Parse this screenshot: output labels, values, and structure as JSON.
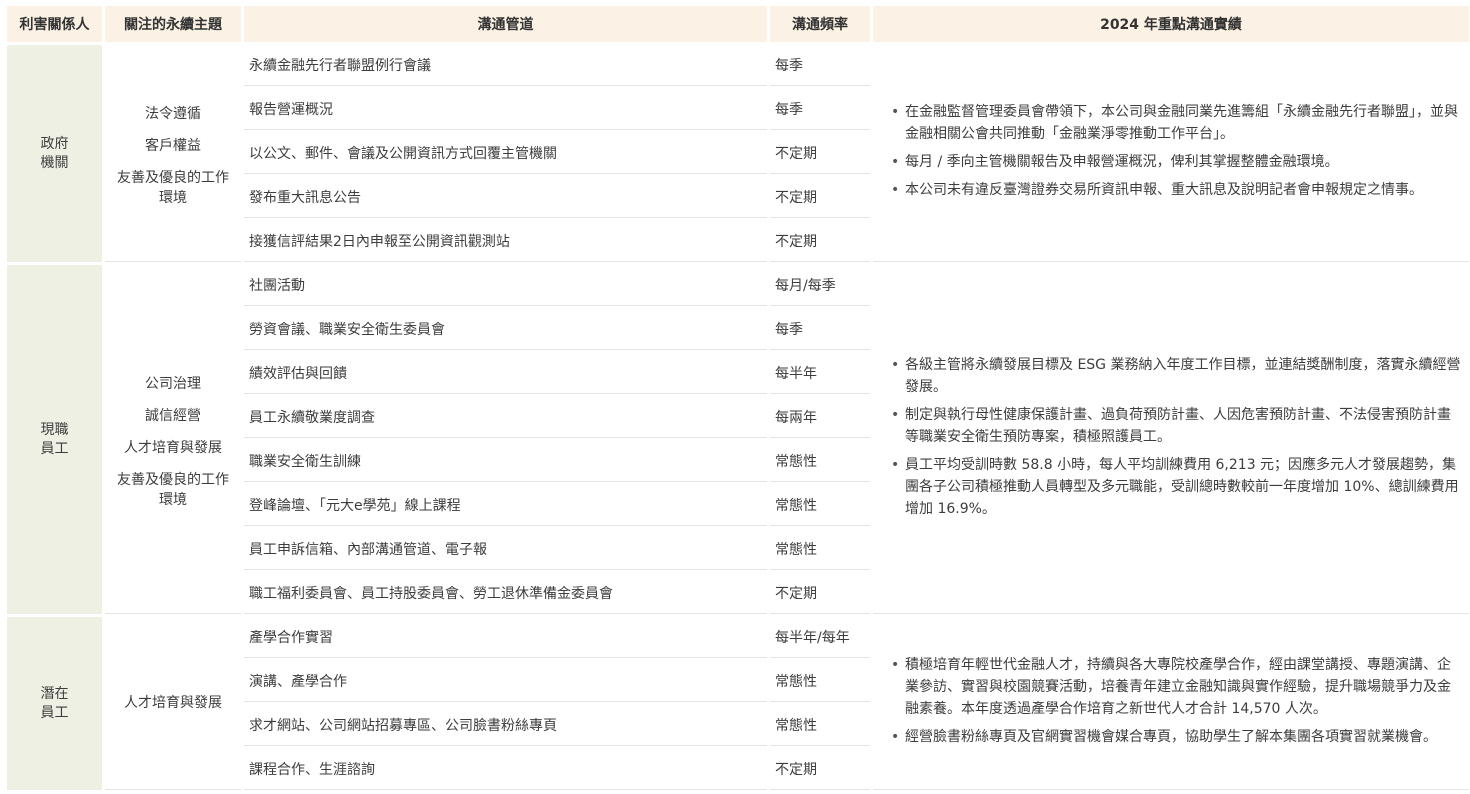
{
  "headers": [
    "利害關係人",
    "關注的永續主題",
    "溝通管道",
    "溝通頻率",
    "2024 年重點溝通實績"
  ],
  "groups": [
    {
      "stakeholder": [
        "政府",
        "機關"
      ],
      "topics": [
        "法令遵循",
        "客戶權益",
        "友善及優良的工作",
        "環境"
      ],
      "rows": [
        {
          "channel": "永續金融先行者聯盟例行會議",
          "freq": "每季"
        },
        {
          "channel": "報告營運概況",
          "freq": "每季"
        },
        {
          "channel": "以公文、郵件、會議及公開資訊方式回覆主管機關",
          "freq": "不定期"
        },
        {
          "channel": "發布重大訊息公告",
          "freq": "不定期"
        },
        {
          "channel": "接獲信評結果2日內申報至公開資訊觀測站",
          "freq": "不定期"
        }
      ],
      "results": [
        "在金融監督管理委員會帶領下，本公司與金融同業先進籌組「永續金融先行者聯盟」，並與金融相關公會共同推動「金融業淨零推動工作平台」。",
        "每月 / 季向主管機關報告及申報營運概況，俾利其掌握整體金融環境。",
        "本公司未有違反臺灣證券交易所資訊申報、重大訊息及說明記者會申報規定之情事。"
      ]
    },
    {
      "stakeholder": [
        "現職",
        "員工"
      ],
      "topics": [
        "公司治理",
        "誠信經營",
        "人才培育與發展",
        "友善及優良的工作",
        "環境"
      ],
      "rows": [
        {
          "channel": "社團活動",
          "freq": "每月/每季"
        },
        {
          "channel": "勞資會議、職業安全衛生委員會",
          "freq": "每季"
        },
        {
          "channel": "績效評估與回饋",
          "freq": "每半年"
        },
        {
          "channel": "員工永續敬業度調查",
          "freq": "每兩年"
        },
        {
          "channel": "職業安全衛生訓練",
          "freq": "常態性"
        },
        {
          "channel": "登峰論壇、「元大e學苑」線上課程",
          "freq": "常態性"
        },
        {
          "channel": "員工申訴信箱、內部溝通管道、電子報",
          "freq": "常態性"
        },
        {
          "channel": "職工福利委員會、員工持股委員會、勞工退休準備金委員會",
          "freq": "不定期"
        }
      ],
      "results": [
        "各級主管將永續發展目標及 ESG 業務納入年度工作目標，並連結獎酬制度，落實永續經營發展。",
        "制定與執行母性健康保護計畫、過負荷預防計畫、人因危害預防計畫、不法侵害預防計畫等職業安全衛生預防專案，積極照護員工。",
        "員工平均受訓時數 58.8 小時，每人平均訓練費用 6,213 元；因應多元人才發展趨勢，集團各子公司積極推動人員轉型及多元職能，受訓總時數較前一年度增加 10%、總訓練費用增加 16.9%。"
      ]
    },
    {
      "stakeholder": [
        "潛在",
        "員工"
      ],
      "topics": [
        "人才培育與發展"
      ],
      "rows": [
        {
          "channel": "產學合作實習",
          "freq": "每半年/每年"
        },
        {
          "channel": "演講、產學合作",
          "freq": "常態性"
        },
        {
          "channel": "求才網站、公司網站招募專區、公司臉書粉絲專頁",
          "freq": "常態性"
        },
        {
          "channel": "課程合作、生涯諮詢",
          "freq": "不定期"
        }
      ],
      "results": [
        "積極培育年輕世代金融人才，持續與各大專院校產學合作，經由課堂講授、專題演講、企業參訪、實習與校園競賽活動，培養青年建立金融知識與實作經驗，提升職場競爭力及金融素養。本年度透過產學合作培育之新世代人才合計 14,570 人次。",
        "經營臉書粉絲專頁及官網實習機會媒合專頁，協助學生了解本集團各項實習就業機會。"
      ]
    }
  ]
}
